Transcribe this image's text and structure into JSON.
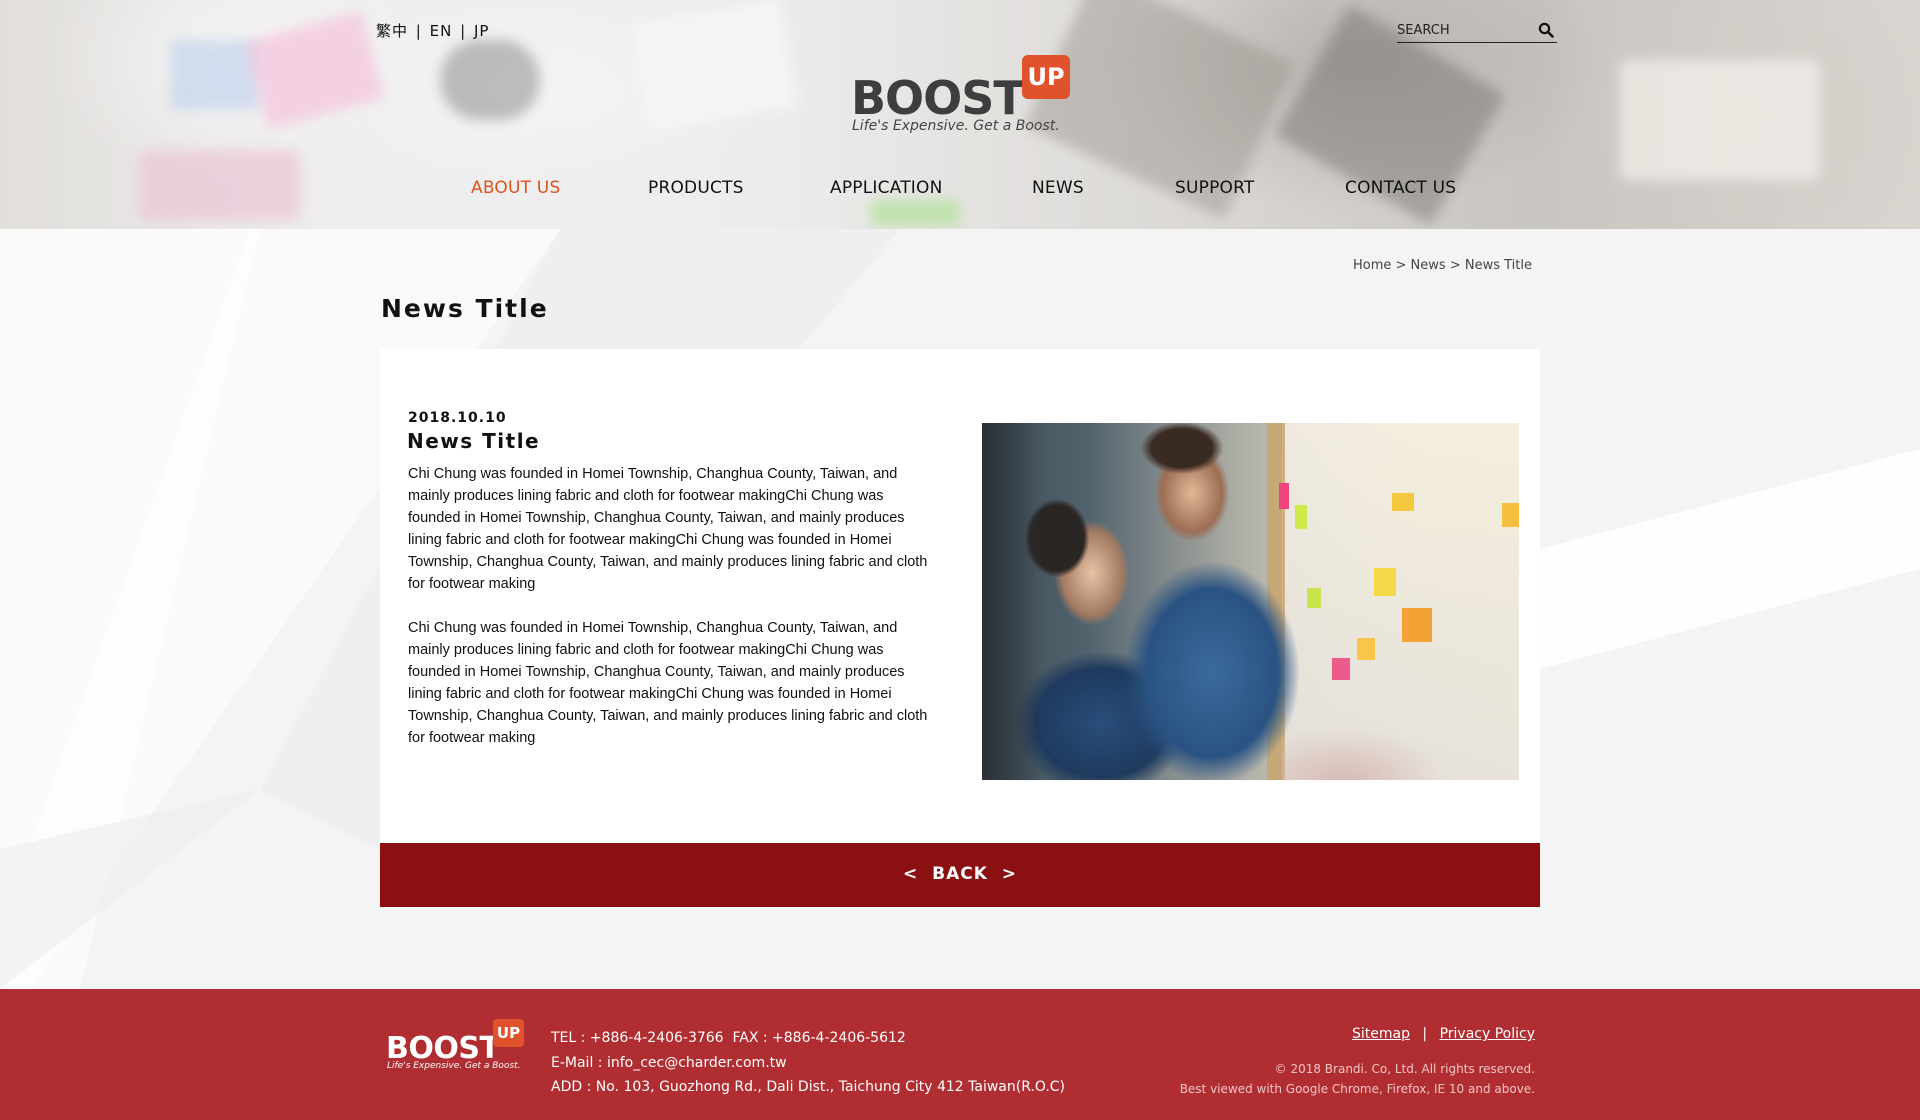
{
  "header": {
    "languages": [
      "繁中",
      "EN",
      "JP"
    ],
    "language_separator": "|",
    "search": {
      "placeholder": "SEARCH"
    },
    "logo": {
      "word": "BOOST",
      "badge": "UP",
      "tagline": "Life's Expensive. Get a Boost."
    },
    "nav": [
      {
        "label": "ABOUT US",
        "active": true
      },
      {
        "label": "PRODUCTS",
        "active": false
      },
      {
        "label": "APPLICATION",
        "active": false
      },
      {
        "label": "NEWS",
        "active": false
      },
      {
        "label": "SUPPORT",
        "active": false
      },
      {
        "label": "CONTACT US",
        "active": false
      }
    ]
  },
  "breadcrumb": {
    "items": [
      "Home",
      "News",
      "News Title"
    ],
    "separator": ">"
  },
  "page_title": "News Title",
  "article": {
    "date": "2018.10.10",
    "title": "News Title",
    "paragraphs": [
      "Chi Chung was founded in Homei Township, Changhua County, Taiwan, and mainly produces lining fabric and cloth for footwear makingChi Chung was founded in Homei Township, Changhua County, Taiwan, and mainly produces lining fabric and cloth for footwear makingChi Chung was founded in Homei Township, Changhua County, Taiwan, and mainly produces lining fabric and cloth for footwear making",
      "Chi Chung was founded in Homei Township, Changhua County, Taiwan, and mainly produces lining fabric and cloth for footwear makingChi Chung was founded in Homei Township, Changhua County, Taiwan, and mainly produces lining fabric and cloth for footwear makingChi Chung was founded in Homei Township, Changhua County, Taiwan, and mainly produces lining fabric and cloth for footwear making"
    ],
    "image_icon": "photo-icon"
  },
  "back_button": {
    "label": "<  BACK  >"
  },
  "footer": {
    "logo": {
      "word": "BOOST",
      "badge": "UP",
      "tagline": "Life's Expensive. Get a Boost."
    },
    "tel": "TEL : +886-4-2406-3766  FAX : +886-4-2406-5612",
    "email": "E-Mail : info_cec@charder.com.tw",
    "address": "ADD : No. 103, Guozhong Rd., Dali Dist., Taichung City 412 Taiwan(R.O.C)",
    "links": {
      "sitemap": "Sitemap",
      "separator": "|",
      "privacy": "Privacy Policy"
    },
    "copyright": "© 2018 Brandi. Co, Ltd. All rights reserved.",
    "browser_note": "Best viewed with Google Chrome, Firefox, IE 10 and above."
  },
  "colors": {
    "accent": "#d9531e",
    "back_bar": "#8c0f12",
    "footer": "#b02e31",
    "logo_badge": "#e0522c"
  }
}
